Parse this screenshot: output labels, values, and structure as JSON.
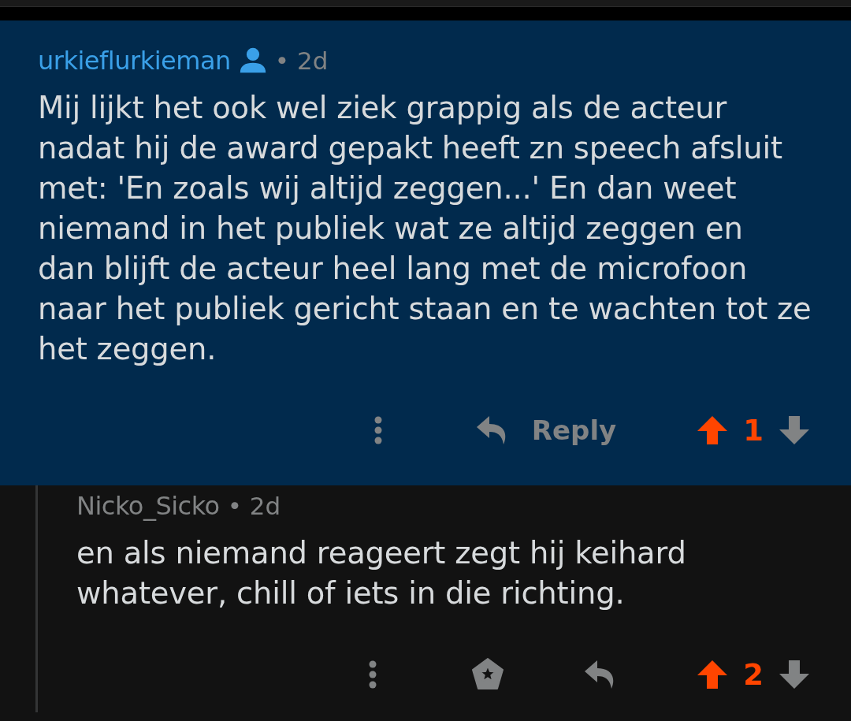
{
  "thread": [
    {
      "author": "urkieflurkieman",
      "person_badge": true,
      "highlighted": true,
      "separator": "•",
      "age": "2d",
      "body": "Mij lijkt het ook wel ziek grappig als de acteur\nnadat hij de award gepakt heeft zn speech afsluit\nmet: 'En zoals wij altijd zeggen...' En dan weet\nniemand in het publiek wat ze altijd zeggen en\ndan blijft de acteur heel lang met de microfoon\nnaar het publiek gericht staan en te wachten tot ze\nhet zeggen.",
      "actions": [
        {
          "kind": "more"
        },
        {
          "kind": "reply",
          "label": "Reply"
        }
      ],
      "score": "1",
      "upvoted": true,
      "downvoted": false,
      "children": [
        {
          "author": "Nicko_Sicko",
          "person_badge": false,
          "highlighted": false,
          "separator": "•",
          "age": "2d",
          "body": "en als niemand reageert zegt hij keihard\nwhatever, chill of iets in die richting.",
          "actions": [
            {
              "kind": "more"
            },
            {
              "kind": "award"
            },
            {
              "kind": "reply"
            }
          ],
          "score": "2",
          "upvoted": true,
          "downvoted": false
        }
      ]
    }
  ]
}
